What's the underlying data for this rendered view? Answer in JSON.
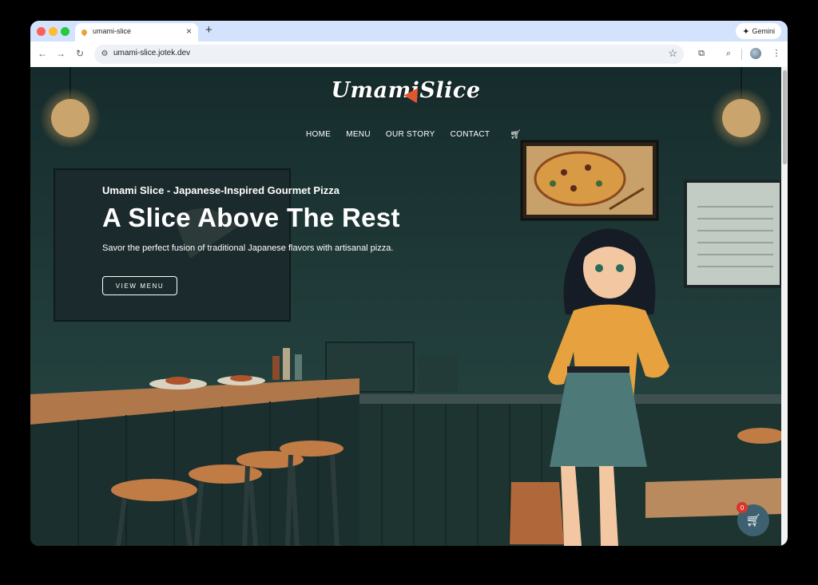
{
  "browser": {
    "tab_title": "umami-slice",
    "url": "umami-slice.jotek.dev",
    "gemini_label": "Gemini"
  },
  "site": {
    "logo": "UmamiSlice",
    "nav": [
      "HOME",
      "MENU",
      "OUR STORY",
      "CONTACT"
    ],
    "subtitle": "Umami Slice - Japanese-Inspired Gourmet Pizza",
    "headline": "A Slice Above The Rest",
    "tagline": "Savor the perfect fusion of traditional Japanese flavors with artisanal pizza.",
    "cta_label": "VIEW MENU",
    "cart_count": "0"
  },
  "colors": {
    "scene_bg": "#1c3434",
    "tab_strip": "#d3e3fd",
    "cart_badge": "#d8362b",
    "float_cart": "#3d6170"
  }
}
